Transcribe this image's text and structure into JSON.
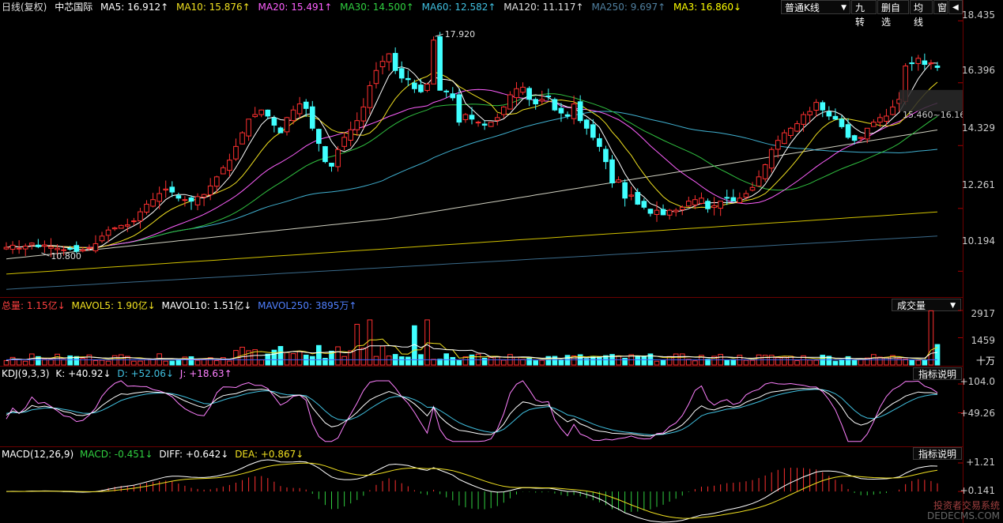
{
  "header": {
    "period": "日线(复权)",
    "name": "中芯国际",
    "ma": [
      {
        "label": "MA5: 16.912↑",
        "color": "#ffffff"
      },
      {
        "label": "MA10: 15.876↑",
        "color": "#f0e020"
      },
      {
        "label": "MA20: 15.491↑",
        "color": "#ff60ff"
      },
      {
        "label": "MA30: 14.500↑",
        "color": "#30d040"
      },
      {
        "label": "MA60: 12.582↑",
        "color": "#40c0e0"
      },
      {
        "label": "MA120: 11.117↑",
        "color": "#e0e0e0"
      },
      {
        "label": "MA250: 9.697↑",
        "color": "#5080a0"
      },
      {
        "label": "MA3: 16.860↓",
        "color": "#ffff00"
      }
    ]
  },
  "toolbar": {
    "kline_type": "普通K线",
    "nine": "九转",
    "delete_self": "删自选",
    "avg": "均线",
    "window": "窗",
    "expand": "◀"
  },
  "price_axis": [
    "18.435",
    "16.396",
    "14.329",
    "12.261",
    "10.194"
  ],
  "price_annotations": {
    "high": "17.920",
    "low": "10.800",
    "range": "15.460~16.160"
  },
  "volume": {
    "header": [
      {
        "label": "总量: 1.15亿↓",
        "color": "#ff4040"
      },
      {
        "label": "MAVOL5: 1.90亿↓",
        "color": "#f0e020"
      },
      {
        "label": "MAVOL10: 1.51亿↓",
        "color": "#ffffff"
      },
      {
        "label": "MAVOL250: 3895万↑",
        "color": "#5080ff"
      }
    ],
    "selector": "成交量",
    "axis": [
      "2917",
      "1459",
      "十万"
    ]
  },
  "kdj": {
    "header": [
      {
        "label": "KDJ(9,3,3)",
        "color": "#ffffff"
      },
      {
        "label": "K: +40.92↓",
        "color": "#ffffff"
      },
      {
        "label": "D: +52.06↓",
        "color": "#40c0e0"
      },
      {
        "label": "J: +18.63↑",
        "color": "#ff80ff"
      }
    ],
    "button": "指标说明",
    "axis": [
      "+104.0",
      "+49.26"
    ]
  },
  "macd": {
    "header": [
      {
        "label": "MACD(12,26,9)",
        "color": "#ffffff"
      },
      {
        "label": "MACD: -0.451↓",
        "color": "#30d040"
      },
      {
        "label": "DIFF: +0.642↓",
        "color": "#ffffff"
      },
      {
        "label": "DEA: +0.867↓",
        "color": "#f0e020"
      }
    ],
    "button": "指标说明",
    "axis": [
      "+1.21",
      "+0.141"
    ]
  },
  "watermark": {
    "line1": "投资者交易系统",
    "line2": "DEDECMS.COM"
  },
  "colors": {
    "up": "#ff3030",
    "down": "#40ffff",
    "grid": "#6b0000"
  },
  "chart_data": {
    "type": "candlestick",
    "ylim": [
      9.5,
      18.6
    ],
    "closes": [
      10.98,
      11.05,
      10.95,
      11.02,
      11.12,
      11.0,
      11.06,
      11.0,
      10.95,
      10.9,
      10.92,
      10.85,
      10.9,
      10.97,
      11.1,
      11.35,
      11.55,
      11.62,
      11.7,
      11.72,
      11.85,
      12.15,
      12.4,
      12.55,
      12.75,
      12.9,
      12.8,
      12.6,
      12.55,
      12.5,
      12.65,
      12.72,
      13.0,
      13.3,
      13.6,
      13.85,
      14.3,
      14.75,
      15.2,
      15.35,
      15.5,
      15.3,
      15.0,
      14.75,
      15.25,
      15.5,
      15.7,
      15.55,
      14.9,
      14.4,
      13.8,
      13.65,
      14.2,
      14.6,
      14.85,
      15.15,
      15.6,
      16.3,
      16.8,
      17.1,
      17.35,
      16.8,
      16.55,
      16.5,
      16.2,
      16.1,
      16.35,
      17.8,
      16.15,
      16.1,
      15.9,
      15.1,
      15.35,
      15.2,
      15.1,
      15.0,
      15.1,
      15.25,
      15.6,
      16.0,
      16.2,
      16.25,
      15.85,
      15.7,
      15.85,
      15.95,
      15.5,
      15.4,
      15.3,
      15.7,
      15.15,
      14.9,
      14.6,
      14.3,
      13.8,
      13.1,
      13.2,
      12.6,
      12.7,
      12.4,
      12.3,
      12.1,
      12.2,
      12.05,
      12.2,
      12.2,
      12.3,
      12.5,
      12.55,
      12.6,
      12.25,
      12.35,
      12.5,
      12.6,
      12.5,
      12.6,
      12.75,
      12.95,
      13.3,
      13.7,
      14.2,
      14.5,
      14.75,
      14.9,
      15.05,
      15.35,
      15.45,
      15.75,
      15.5,
      15.3,
      15.2,
      14.95,
      14.6,
      14.5,
      14.6,
      14.9,
      15.1,
      15.25,
      15.3,
      15.6,
      15.85,
      16.95,
      17.05,
      17.2,
      17.0,
      17.05,
      16.9
    ]
  }
}
